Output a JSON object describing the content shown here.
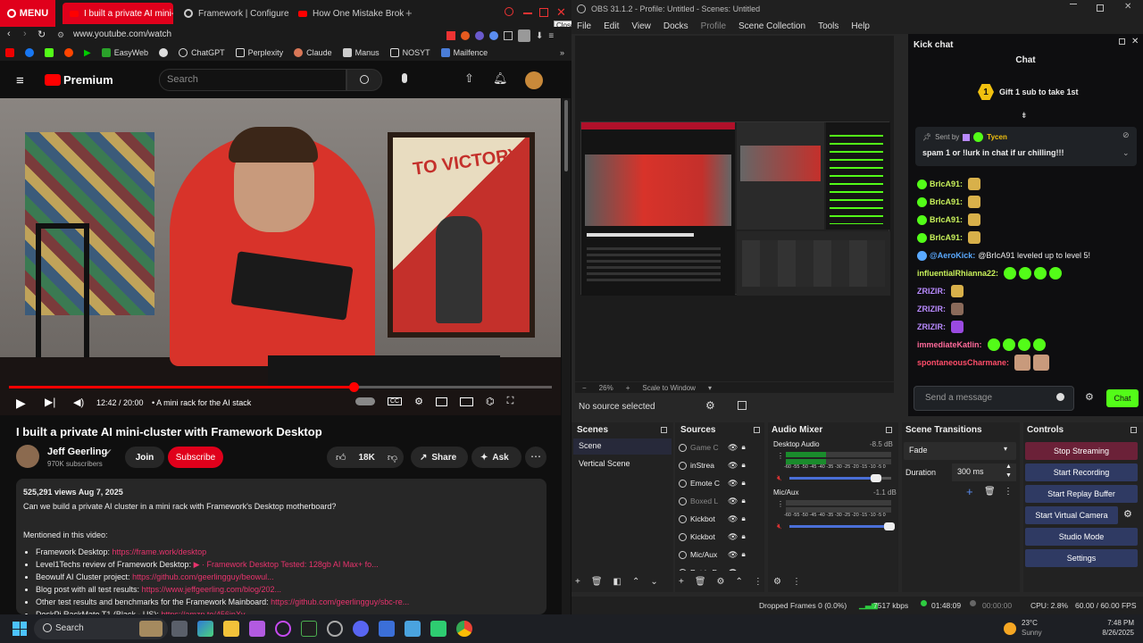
{
  "browser": {
    "menu_label": "MENU",
    "tabs": [
      {
        "label": "I built a private AI mini-clu"
      },
      {
        "label": "Framework | Configure Fr"
      },
      {
        "label": "How One Mistake Broke C"
      }
    ],
    "close_tooltip": "Close",
    "url": "www.youtube.com/watch",
    "bookmarks": [
      "EasyWeb",
      "ChatGPT",
      "Perplexity",
      "Claude",
      "Manus",
      "NOSYT",
      "Mailfence"
    ]
  },
  "youtube": {
    "logo_text": "Premium",
    "search_placeholder": "Search",
    "player": {
      "time": "12:42 / 20:00",
      "chapter": "• A mini rack for the AI stack",
      "progress": 0.635,
      "poster_text": "TO VICTORY!"
    },
    "title": "I built a private AI mini-cluster with Framework Desktop",
    "channel": "Jeff Geerling",
    "subscribers": "970K subscribers",
    "join": "Join",
    "subscribe": "Subscribe",
    "likes": "18K",
    "share": "Share",
    "ask": "Ask",
    "views_date": "525,291 views  Aug 7, 2025",
    "description_line": "Can we build a private AI cluster in a mini rack with Framework's Desktop motherboard?",
    "mentioned": "Mentioned in this video:",
    "links": [
      {
        "label": "Framework Desktop:",
        "url": "https://frame.work/desktop"
      },
      {
        "label": "Level1Techs review of Framework Desktop:",
        "url": "▶ · Framework Desktop Tested: 128gb AI Max+ fo..."
      },
      {
        "label": "Beowulf AI Cluster project:",
        "url": "https://github.com/geerlingguy/beowul..."
      },
      {
        "label": "Blog post with all test results:",
        "url": "https://www.jeffgeerling.com/blog/202..."
      },
      {
        "label": "Other test results and benchmarks for the Framework Mainboard:",
        "url": "https://github.com/geerlingguy/sbc-re..."
      },
      {
        "label": "DeskPi RackMate T1 (Black - US):",
        "url": "https://amzn.to/456jnXv"
      }
    ]
  },
  "obs": {
    "title": "OBS 31.1.2 - Profile: Untitled - Scenes: Untitled",
    "menu": [
      "File",
      "Edit",
      "View",
      "Docks",
      "Profile",
      "Scene Collection",
      "Tools",
      "Help"
    ],
    "zoom": "26%",
    "scale": "Scale to Window",
    "no_source": "No source selected",
    "scenes_title": "Scenes",
    "scenes": [
      "Scene",
      "Vertical Scene"
    ],
    "sources_title": "Sources",
    "sources": [
      "Game C",
      "inStrea",
      "Emote C",
      "Boxed L",
      "Kickbot",
      "Kickbot",
      "Mic/Aux",
      "Retrix F"
    ],
    "mixer_title": "Audio Mixer",
    "mixer": [
      {
        "name": "Desktop Audio",
        "db": "-8.5 dB",
        "level": 0.85
      },
      {
        "name": "Mic/Aux",
        "db": "-1.1 dB",
        "level": 0.98
      }
    ],
    "meter_scale": "-60 -55 -50 -45 -40 -35 -30 -25 -20 -15 -10 -5 0",
    "transitions_title": "Scene Transitions",
    "transition": "Fade",
    "duration_label": "Duration",
    "duration": "300 ms",
    "controls_title": "Controls",
    "controls": [
      "Stop Streaming",
      "Start Recording",
      "Start Replay Buffer",
      "Start Virtual Camera",
      "Studio Mode",
      "Settings"
    ],
    "status": {
      "dropped": "Dropped Frames 0 (0.0%)",
      "kbps": "7517 kbps",
      "stream_time": "01:48:09",
      "rec_time": "00:00:00",
      "cpu": "CPU: 2.8%",
      "fps": "60.00 / 60.00 FPS"
    }
  },
  "kick": {
    "dock_title": "Kick chat",
    "chat_title": "Chat",
    "gift": "Gift 1 sub to take 1st",
    "gift_count": "1",
    "pinned_by": "Sent by",
    "pinned_user": "Tycen",
    "pinned_msg": "spam 1 or !lurk in chat if ur chilling!!!",
    "messages": [
      {
        "user": "BrIcA91:",
        "color": "#c9f25b",
        "text": ""
      },
      {
        "user": "BrIcA91:",
        "color": "#c9f25b",
        "text": ""
      },
      {
        "user": "BrIcA91:",
        "color": "#c9f25b",
        "text": ""
      },
      {
        "user": "BrIcA91:",
        "color": "#c9f25b",
        "text": ""
      },
      {
        "user": "@AeroKick:",
        "color": "#5aa9ff",
        "text": "@BrIcA91 leveled up to level 5!"
      },
      {
        "user": "influentialRhianna22:",
        "color": "#c9f25b",
        "text": ""
      },
      {
        "user": "ZRIZIR:",
        "color": "#b98bff",
        "text": ""
      },
      {
        "user": "ZRIZIR:",
        "color": "#b98bff",
        "text": ""
      },
      {
        "user": "ZRIZIR:",
        "color": "#b98bff",
        "text": ""
      },
      {
        "user": "immediateKatlin:",
        "color": "#ff6a9a",
        "text": ""
      },
      {
        "user": "spontaneousCharmane:",
        "color": "#ff4d6a",
        "text": ""
      }
    ],
    "input_placeholder": "Send a message",
    "chat_button": "Chat"
  },
  "taskbar": {
    "search": "Search",
    "temp": "23°C",
    "weather": "Sunny",
    "time": "7:48 PM",
    "date": "8/26/2025"
  }
}
